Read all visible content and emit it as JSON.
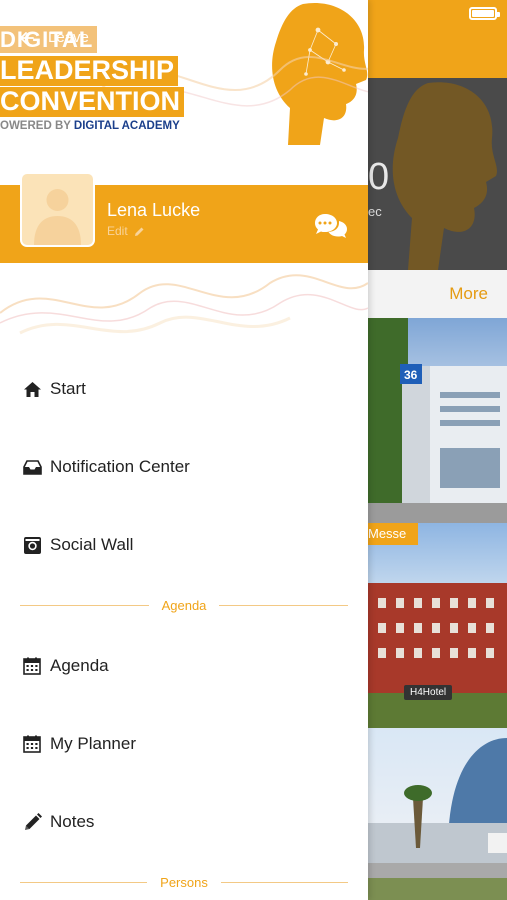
{
  "background_app": {
    "countdown_value": "0",
    "countdown_unit": "ec",
    "more_label": "More",
    "venue_tag": "Messe",
    "hotel_sign": "H4Hotel"
  },
  "drawer": {
    "logo": {
      "line1": "DIGITAL",
      "line2": "LEADERSHIP",
      "line3": "CONVENTION",
      "powered_prefix": "OWERED BY ",
      "powered_brand": "DIGITAL ACADEMY"
    },
    "leave_label": "Leave",
    "profile": {
      "name": "Lena Lucke",
      "edit_label": "Edit"
    },
    "menu": [
      {
        "label": "Start",
        "icon": "home-icon"
      },
      {
        "label": "Notification Center",
        "icon": "inbox-icon"
      },
      {
        "label": "Social Wall",
        "icon": "camera-icon"
      },
      {
        "label": "Agenda",
        "icon": "calendar-icon"
      },
      {
        "label": "My Planner",
        "icon": "calendar-icon"
      },
      {
        "label": "Notes",
        "icon": "pencil-icon"
      }
    ],
    "sections": {
      "agenda": "Agenda",
      "persons": "Persons"
    }
  },
  "colors": {
    "accent": "#f0a419",
    "brand_blue": "#1b3f8b",
    "text": "#222222"
  }
}
